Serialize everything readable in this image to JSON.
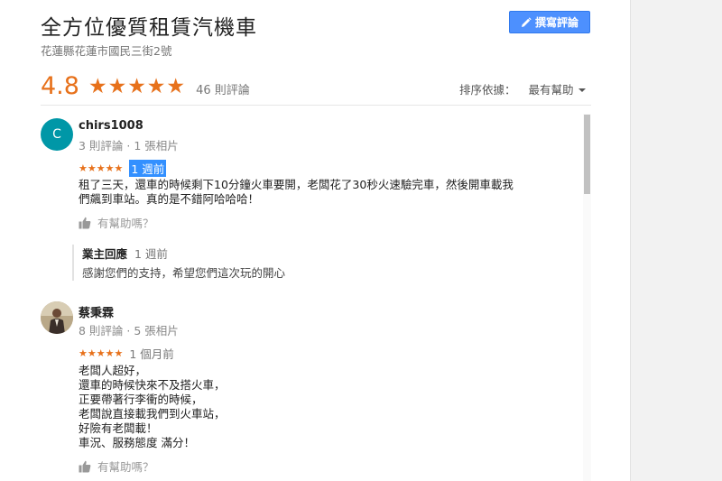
{
  "business": {
    "title": "全方位優質租賃汽機車",
    "address": "花蓮縣花蓮市國民三街2號",
    "write_review_label": "撰寫評論"
  },
  "summary": {
    "rating": "4.8",
    "stars": "★★★★★",
    "review_count": "46 則評論",
    "sort_label": "排序依據：",
    "sort_value": "最有幫助"
  },
  "reviews": [
    {
      "avatar_letter": "C",
      "name": "chirs1008",
      "meta": "3 則評論 · 1 張相片",
      "stars": "★★★★★",
      "time": "1 週前",
      "text": "租了三天，還車的時候剩下10分鐘火車要開，老闆花了30秒火速驗完車，然後開車載我\n們飆到車站。真的是不錯阿哈哈哈！",
      "helpful": "有幫助嗎？",
      "owner_reply": {
        "label": "業主回應",
        "time": "1 週前",
        "text": "感謝您們的支持，希望您們這次玩的開心"
      }
    },
    {
      "name": "蔡秉霖",
      "meta": "8 則評論 · 5 張相片",
      "stars": "★★★★★",
      "time": "1 個月前",
      "text": "老闆人超好，\n還車的時候快來不及搭火車，\n正要帶著行李衝的時候，\n老闆說直接載我們到火車站，\n好險有老闆載！\n車況、服務態度 滿分！",
      "helpful": "有幫助嗎？"
    }
  ],
  "icons": {
    "edit": "pencil-icon",
    "thumb": "thumbs-up-icon",
    "sort": "chevron-down-icon"
  },
  "colors": {
    "accent": "#e7711b",
    "button": "#4d90fe",
    "selection": "#3390ff",
    "avatar": "#0097a7"
  }
}
